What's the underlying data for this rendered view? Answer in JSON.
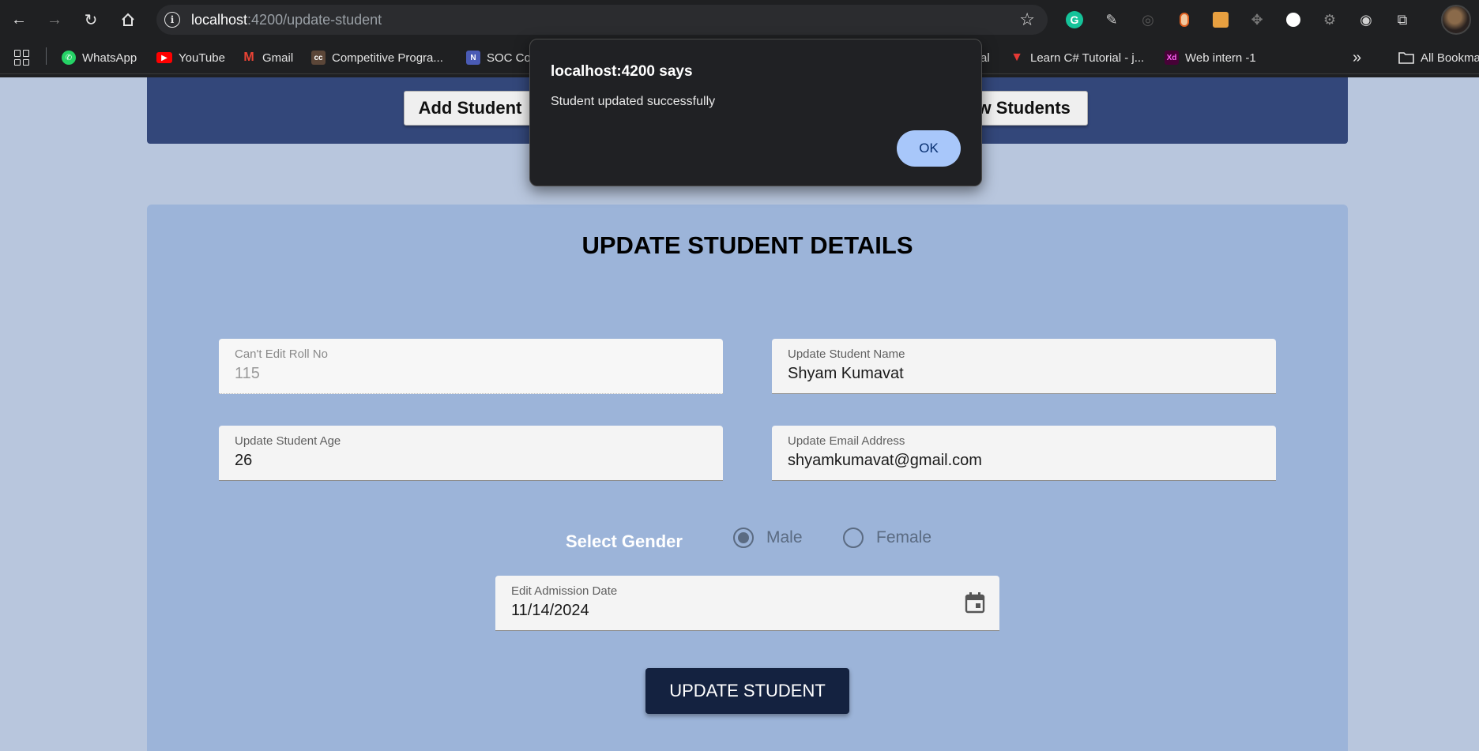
{
  "browser": {
    "url_host": "localhost",
    "url_path": ":4200/update-student",
    "bookmarks": [
      {
        "label": "WhatsApp",
        "icon": "whatsapp-icon",
        "color": "#25d366"
      },
      {
        "label": "YouTube",
        "icon": "youtube-icon",
        "color": "#ff0000"
      },
      {
        "label": "Gmail",
        "icon": "gmail-icon",
        "color": "#ea4335"
      },
      {
        "label": "Competitive Progra...",
        "icon": "codechef-icon",
        "color": "#5b4638"
      },
      {
        "label": "SOC Co",
        "icon": "notion-icon",
        "color": "#4a5bb5"
      },
      {
        "label": "al",
        "icon": "bookmark-icon",
        "color": "#888888"
      },
      {
        "label": "Learn C# Tutorial - j...",
        "icon": "tutorial-icon",
        "color": "#e53935"
      },
      {
        "label": "Web intern -1",
        "icon": "xd-icon",
        "color": "#470137"
      },
      {
        "label": "All Bookma",
        "icon": "folder-icon",
        "color": "#e3e3e3"
      }
    ],
    "bookmark_glyphs": {
      "codechef": "cc",
      "notion": "N",
      "xd": "Xd"
    }
  },
  "nav": {
    "add_student": "Add Student",
    "show_students": "Show Students",
    "show_students_visible": "ow Students"
  },
  "form": {
    "title": "UPDATE STUDENT DETAILS",
    "roll": {
      "label": "Can't Edit Roll No",
      "value": "115"
    },
    "name": {
      "label": "Update Student Name",
      "value": "Shyam Kumavat"
    },
    "age": {
      "label": "Update Student Age",
      "value": "26"
    },
    "email": {
      "label": "Update Email Address",
      "value": "shyamkumavat@gmail.com"
    },
    "gender": {
      "label": "Select Gender",
      "options": [
        "Male",
        "Female"
      ],
      "selected": "Male"
    },
    "date": {
      "label": "Edit Admission Date",
      "value": "11/14/2024"
    },
    "submit": "UPDATE STUDENT"
  },
  "dialog": {
    "title": "localhost:4200 says",
    "message": "Student updated successfully",
    "ok": "OK"
  },
  "colors": {
    "navbar": "#33477a",
    "card": "#9cb4d9",
    "submit": "#142240",
    "dialog_button": "#a8c7fa"
  }
}
